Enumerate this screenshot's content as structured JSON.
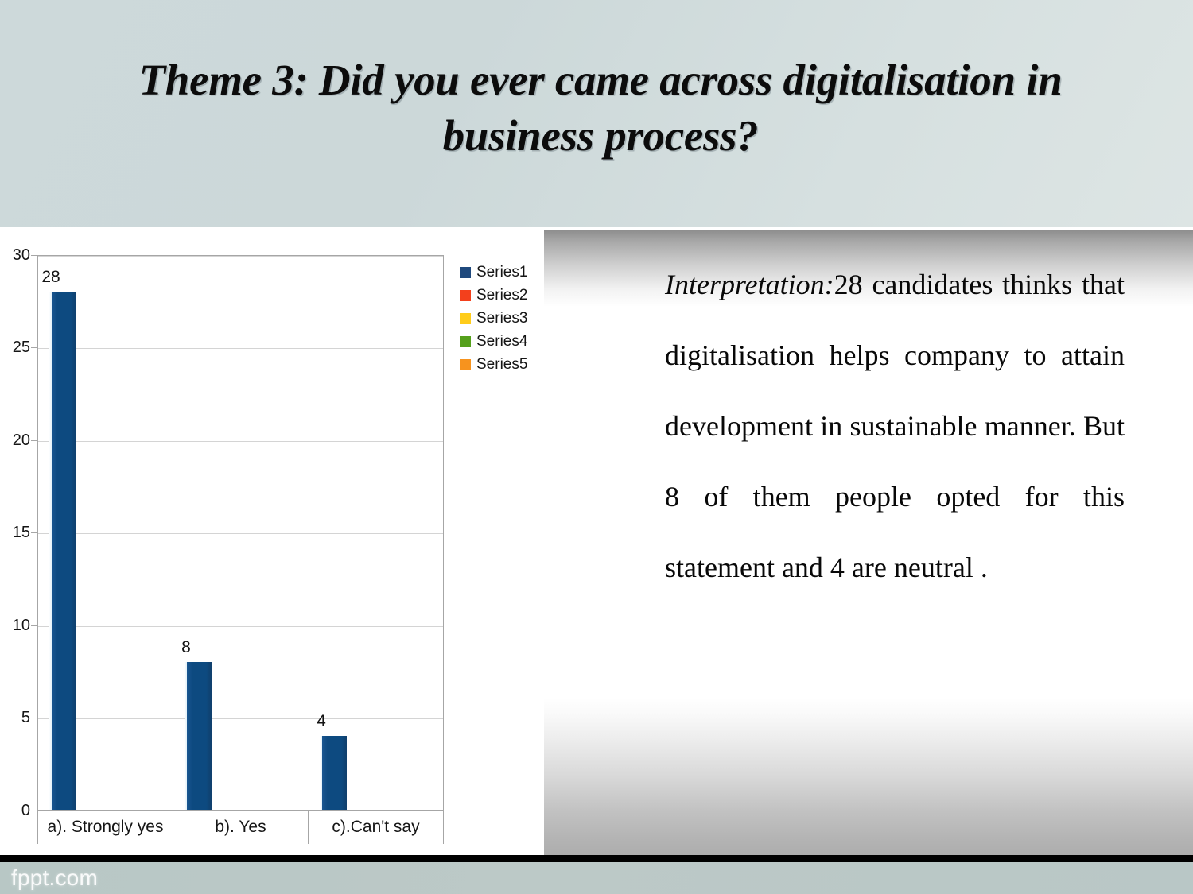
{
  "slide": {
    "title": "Theme 3: Did you ever came across digitalisation in business process?"
  },
  "chart_data": {
    "type": "bar",
    "title": "",
    "xlabel": "",
    "ylabel": "",
    "categories": [
      "a). Strongly yes",
      "b).  Yes",
      "c).Can't say"
    ],
    "values": [
      28,
      8,
      4
    ],
    "data_labels": [
      "28",
      "8",
      "4"
    ],
    "ylim": [
      0,
      30
    ],
    "yticks": [
      0,
      5,
      10,
      15,
      20,
      25,
      30
    ],
    "ytick_labels": [
      "0",
      "5",
      "10",
      "15",
      "20",
      "25",
      "30"
    ],
    "grid": true,
    "legend_position": "right",
    "series": [
      {
        "name": "Series1",
        "color": "#1F497D",
        "values": [
          28,
          8,
          4
        ]
      },
      {
        "name": "Series2",
        "color": "#F3401C",
        "values": []
      },
      {
        "name": "Series3",
        "color": "#FFCC1A",
        "values": []
      },
      {
        "name": "Series4",
        "color": "#55A01C",
        "values": []
      },
      {
        "name": "Series5",
        "color": "#F7931E",
        "values": []
      }
    ]
  },
  "interpretation": {
    "lead": "Interpretation:",
    "body": "28 candidates thinks that digitalisation helps company to attain development in sustainable manner. But 8 of them people opted for this",
    "tail": "statement and 4 are neutral ."
  },
  "footer": {
    "watermark": "fppt.com"
  },
  "colors": {
    "bar": "#0d4a80",
    "header_band": "#ccd8d9",
    "footer_band": "#b9c7c6",
    "gridline": "#d4d4d4",
    "plot_border": "#a6a6a6"
  }
}
